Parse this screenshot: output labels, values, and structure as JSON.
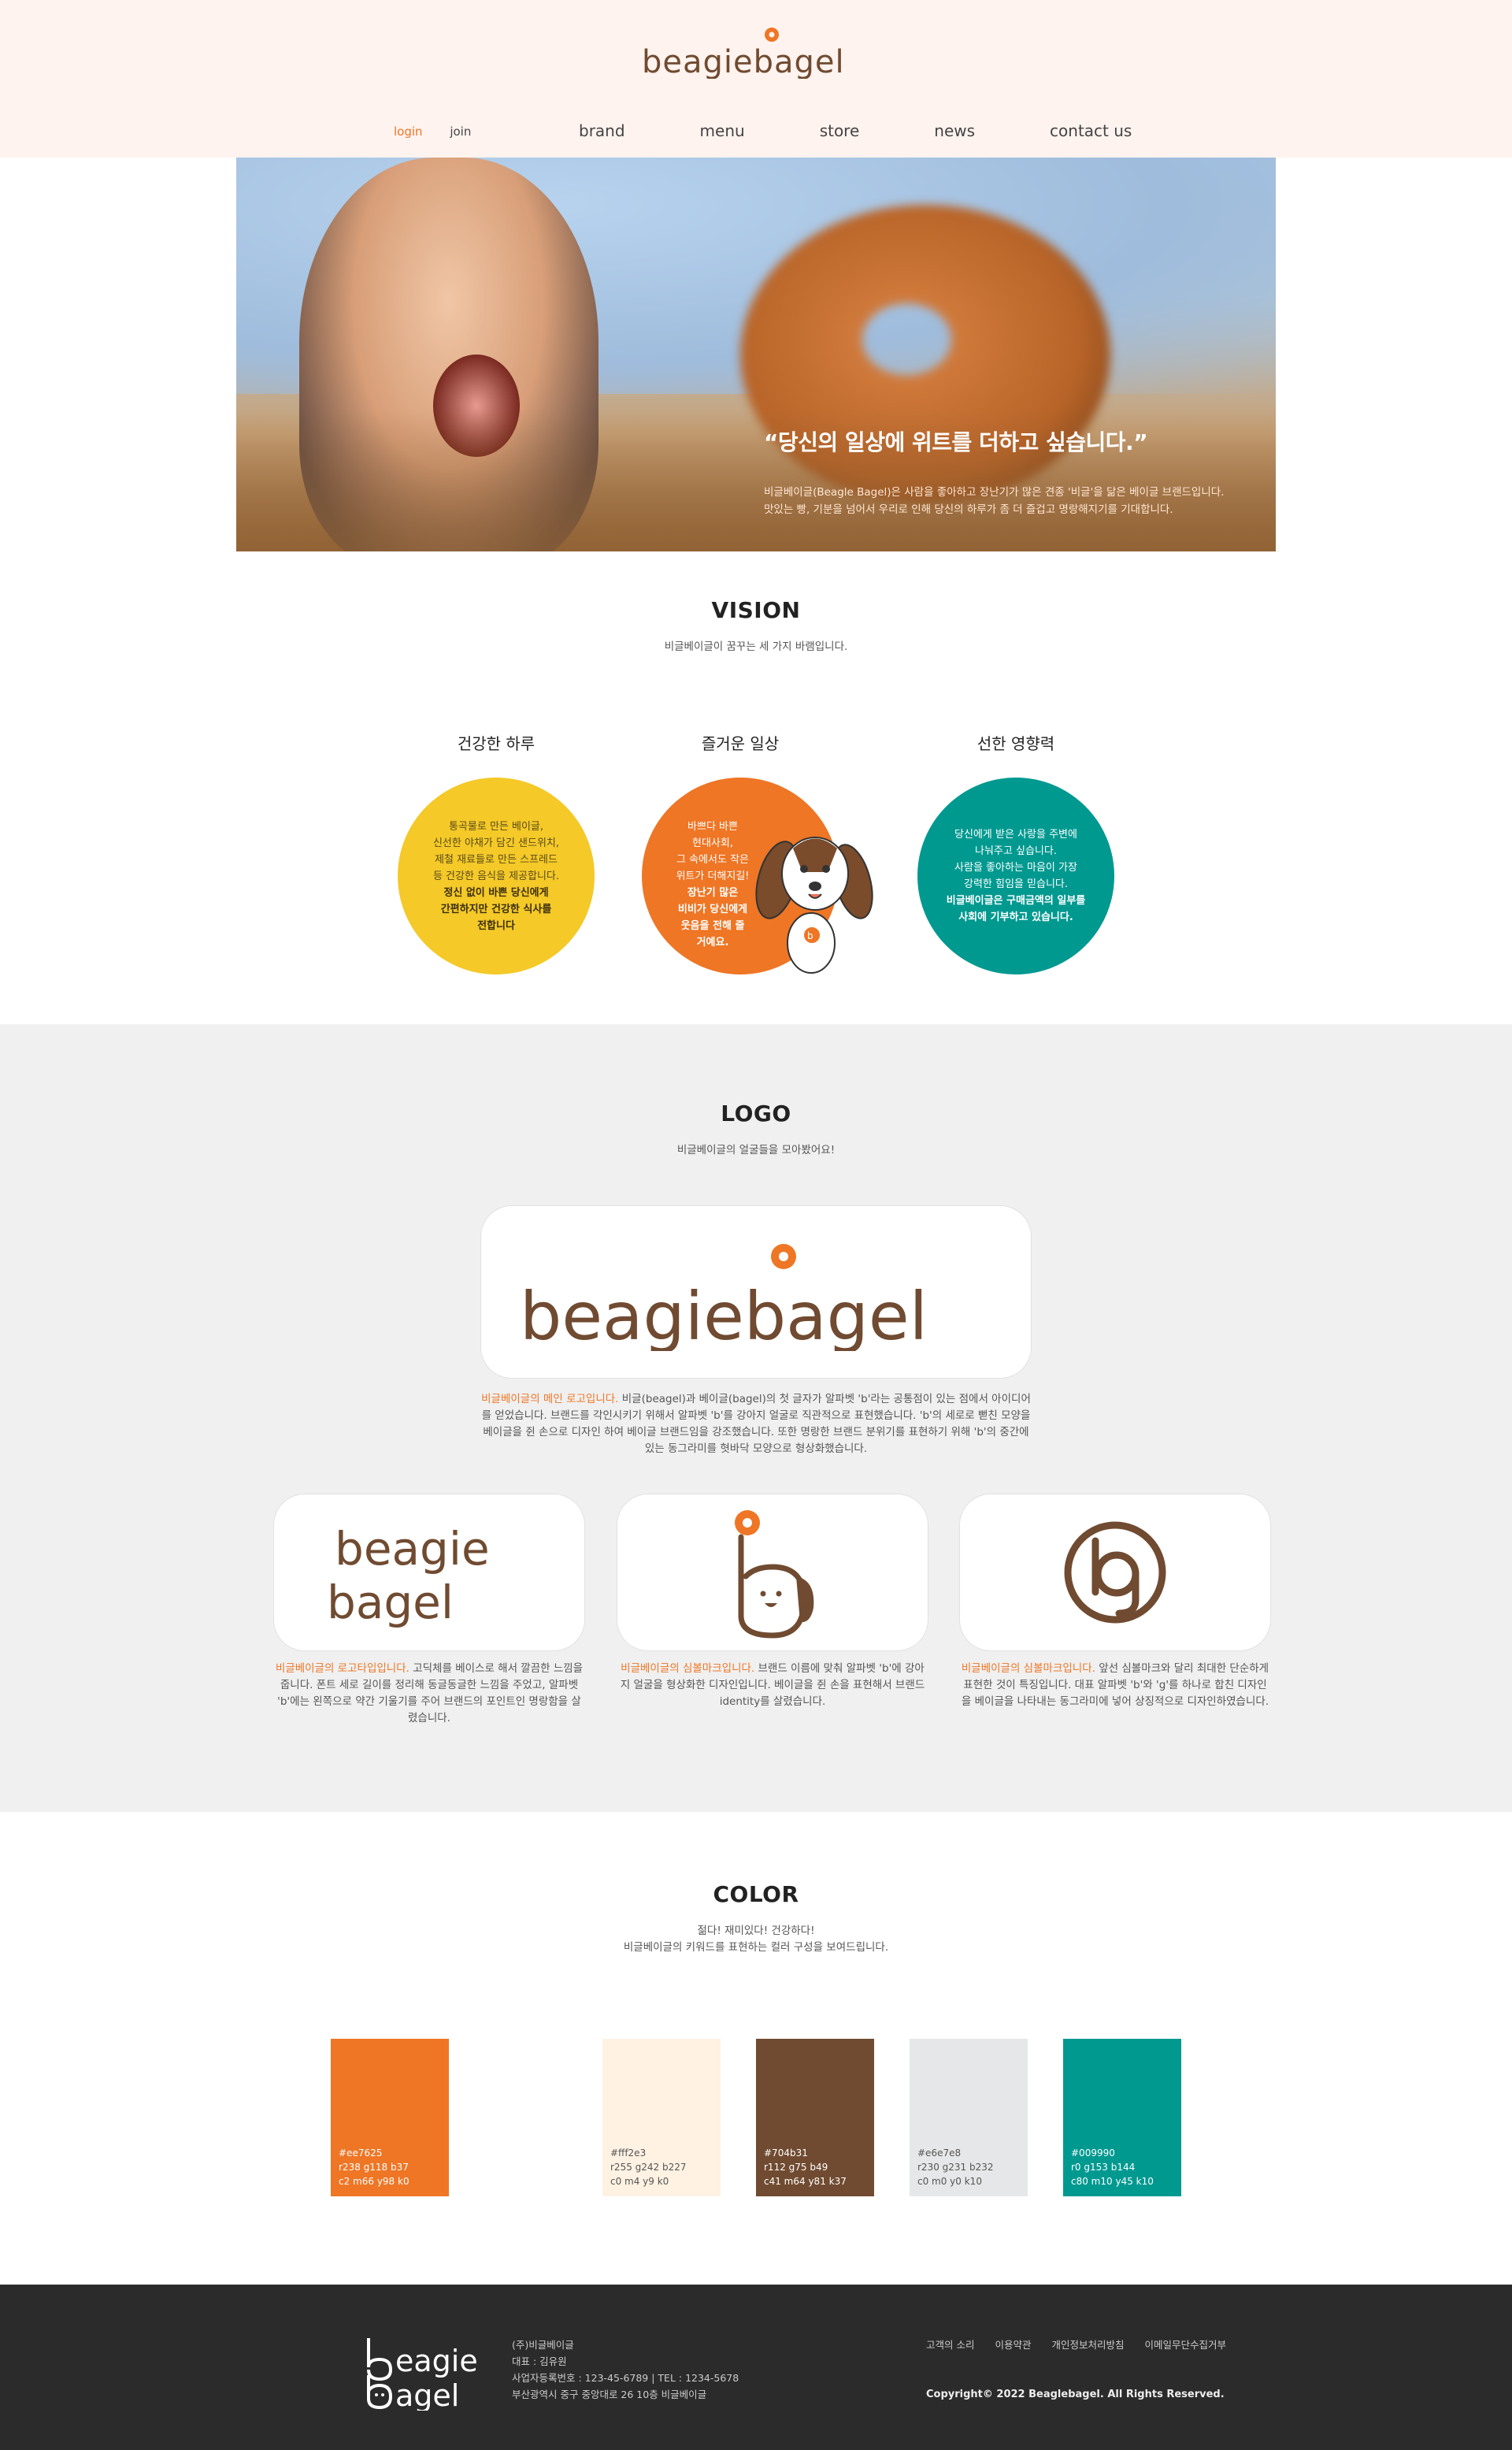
{
  "header": {
    "brand_name": "beagiebagel",
    "login": "login",
    "join": "join",
    "menu": [
      "brand",
      "menu",
      "store",
      "news",
      "contact us"
    ]
  },
  "hero": {
    "headline": "“당신의 일상에 위트를 더하고 싶습니다.”",
    "desc_1": "비글베이글(Beagle Bagel)은 사람을 좋아하고 장난기가 많은 견종 '비글'을 닮은 베이글 브랜드입니다.",
    "desc_2": "맛있는 빵, 기분을 넘어서 우리로 인해 당신의 하루가 좀 더 즐겁고 명랑해지기를 기대합니다."
  },
  "vision": {
    "title": "VISION",
    "subtitle": "비글베이글이 꿈꾸는 세 가지 바램입니다.",
    "items": [
      {
        "title": "건강한 하루",
        "lines": [
          "통곡물로 만든 베이글,",
          "신선한 야채가 담긴 샌드위치,",
          "제철 재료들로 만든 스프레드",
          "등 건강한 음식을 제공합니다."
        ],
        "bold": [
          "정신 없이 바쁜 당신에게",
          "간편하지만 건강한 식사를",
          "전합니다"
        ]
      },
      {
        "title": "즐거운 일상",
        "lines": [
          "바쁘다 바쁜",
          "현대사회,",
          "그 속에서도 작은",
          "위트가 더해지길!"
        ],
        "bold": [
          "장난기 많은",
          "비비가 당신에게",
          "웃음을 전해 줄",
          "거예요."
        ]
      },
      {
        "title": "선한 영향력",
        "lines": [
          "당신에게 받은 사랑을 주변에",
          "나눠주고 싶습니다.",
          "사람을 좋아하는 마음이 가장",
          "강력한 힘임을 믿습니다."
        ],
        "bold": [
          "비글베이글은 구매금액의 일부를",
          "사회에 기부하고 있습니다."
        ]
      }
    ]
  },
  "logo_section": {
    "title": "LOGO",
    "subtitle": "비글베이글의 얼굴들을 모아봤어요!",
    "main_logo_text": "beagiebagel",
    "main_highlight": "비글베이글의 메인 로고입니다.",
    "main_desc": "비글(beagel)과 베이글(bagel)의 첫 글자가 알파벳 'b'라는 공통점이 있는 점에서 아이디어를 얻었습니다. 브랜드를 각인시키기 위해서 알파벳 'b'를 강아지 얼굴로 직관적으로 표현했습니다. 'b'의 세로로 뻗친 모양을 베이글을 쥔 손으로 디자인 하여 베이글 브랜드임을 강조했습니다. 또한 명랑한 브랜드 분위기를 표현하기 위해 'b'의 중간에 있는 동그라미를 혓바닥 모양으로 형상화했습니다.",
    "cards": [
      {
        "logo_line1": "beagie",
        "logo_line2": "bagel",
        "highlight": "비글베이글의 로고타입입니다.",
        "desc": "고딕체를 베이스로 해서 깔끔한 느낌을 줍니다. 폰트 세로 길이를 정리해 동글동글한 느낌을 주었고, 알파벳 'b'에는 왼쪽으로 약간 기울기를 주어 브랜드의 포인트인 명랑함을 살렸습니다."
      },
      {
        "highlight": "비글베이글의 심볼마크입니다.",
        "desc": "브랜드 이름에 맞춰 알파벳 'b'에 강아지 얼굴을 형상화한 디자인입니다. 베이글을 쥔 손을 표현해서 브랜드 identity를 살렸습니다."
      },
      {
        "highlight": "비글베이글의 심볼마크입니다.",
        "desc": "앞선 심볼마크와 달리 최대한 단순하게 표현한 것이 특징입니다. 대표 알파벳 'b'와 'g'를 하나로 합친 디자인을 베이글을 나타내는 동그라미에 넣어 상징적으로 디자인하였습니다."
      }
    ]
  },
  "color_section": {
    "title": "COLOR",
    "subtitle_1": "젊다! 재미있다! 건강하다!",
    "subtitle_2": "비글베이글의 키워드를 표현하는 컬러 구성을 보여드립니다.",
    "swatches": [
      {
        "hex": "#ee7625",
        "rgb": "r238 g118 b37",
        "cmyk": "c2 m66 y98 k0",
        "text_color": "#ffffff"
      },
      {
        "hex": "#fff2e3",
        "rgb": "r255 g242 b227",
        "cmyk": "c0 m4 y9 k0",
        "text_color": "#555555"
      },
      {
        "hex": "#704b31",
        "rgb": "r112 g75 b49",
        "cmyk": "c41 m64 y81 k37",
        "text_color": "#ffffff"
      },
      {
        "hex": "#e6e7e8",
        "rgb": "r230 g231 b232",
        "cmyk": "c0 m0 y0 k10",
        "text_color": "#555555"
      },
      {
        "hex": "#009990",
        "rgb": "r0 g153 b144",
        "cmyk": "c80 m10 y45 k10",
        "text_color": "#ffffff"
      }
    ]
  },
  "footer": {
    "logo_line1": "eagie",
    "logo_line2": "agel",
    "company": "(주)비글베이글",
    "ceo": "대표 : 김유원",
    "biz": "사업자등록번호 : 123-45-6789   |   TEL : 1234-5678",
    "address": "부산광역시 중구 중앙대로 26 10층 비글베이글",
    "links": [
      "고객의 소리",
      "이용약관",
      "개인정보처리방침",
      "이메일무단수집거부"
    ],
    "copyright": "Copyright© 2022 Beaglebagel. All Rights Reserved."
  },
  "colors": {
    "orange": "#ee7625",
    "brown": "#704b31",
    "teal": "#009990",
    "yellow": "#f4c928",
    "header_bg": "#fff3ef",
    "footer_bg": "#2b2b2b"
  }
}
